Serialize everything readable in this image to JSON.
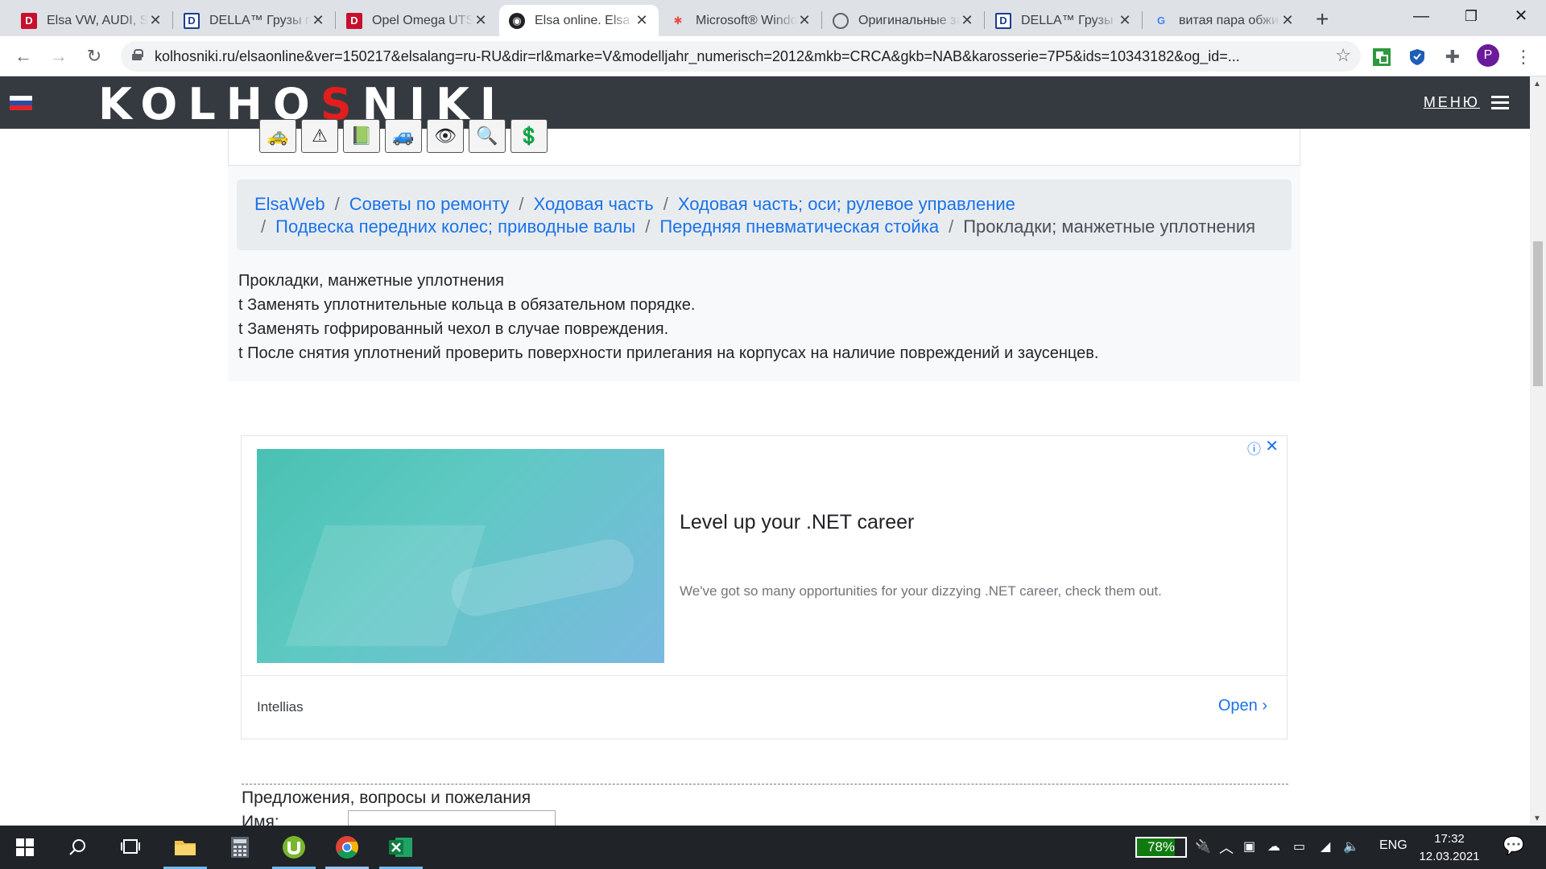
{
  "browser": {
    "tabs": [
      {
        "title": "Elsa VW, AUDI, SKODA",
        "favicon": "della-red-icon"
      },
      {
        "title": "DELLA™ Грузы по Украине",
        "favicon": "della-blue-icon"
      },
      {
        "title": "Opel Omega UTS",
        "favicon": "della-red-icon"
      },
      {
        "title": "Elsa online. Elsa",
        "favicon": "elsa-icon",
        "active": true
      },
      {
        "title": "Microsoft® Windows",
        "favicon": "microsoft-icon"
      },
      {
        "title": "Оригинальные запчасти",
        "favicon": "globe-icon"
      },
      {
        "title": "DELLA™ Грузы по",
        "favicon": "della-blue-icon"
      },
      {
        "title": "витая пара обжим",
        "favicon": "google-icon"
      }
    ],
    "url": "kolhosniki.ru/elsaonline&ver=150217&elsalang=ru-RU&dir=rl&marke=V&modelljahr_numerisch=2012&mkb=CRCA&gkb=NAB&karosserie=7P5&ids=10343182&og_id=...",
    "profile_initial": "P"
  },
  "site": {
    "brand_pre": "KOLHO",
    "brand_s": "S",
    "brand_post": "NIKI",
    "menu_label": "МЕНЮ",
    "flag_colors": [
      "#ffffff",
      "#2b4ea2",
      "#e0262b"
    ]
  },
  "toolbar_icons": [
    "car-icon",
    "warning-icon",
    "book-icon",
    "car-repair-icon",
    "diagnostic-icon",
    "search-icon",
    "money-icon"
  ],
  "breadcrumb": {
    "items": [
      "ElsaWeb",
      "Советы по ремонту",
      "Ходовая часть",
      "Ходовая часть; оси; рулевое управление",
      "Подвеска передних колес; приводные валы",
      "Передняя пневматическая стойка"
    ],
    "current": "Прокладки; манжетные уплотнения"
  },
  "article": {
    "title": "Прокладки, манжетные уплотнения",
    "bullet": "t",
    "lines": [
      "Заменять уплотнительные кольца в обязательном порядке.",
      "Заменять гофрированный чехол в случае повреждения.",
      "После снятия уплотнений проверить поверхности прилегания на корпусах на наличие повреждений и заусенцев."
    ]
  },
  "ad": {
    "title": "Level up your .NET career",
    "description": "We've got so many opportunities for your dizzying .NET career, check them out.",
    "advertiser": "Intellias",
    "cta": "Open"
  },
  "form": {
    "title": "Предложения, вопросы и пожелания",
    "name_label": "Имя:"
  },
  "taskbar": {
    "battery_percent": 78,
    "battery_label": "78%",
    "language": "ENG",
    "time": "17:32",
    "date": "12.03.2021"
  }
}
